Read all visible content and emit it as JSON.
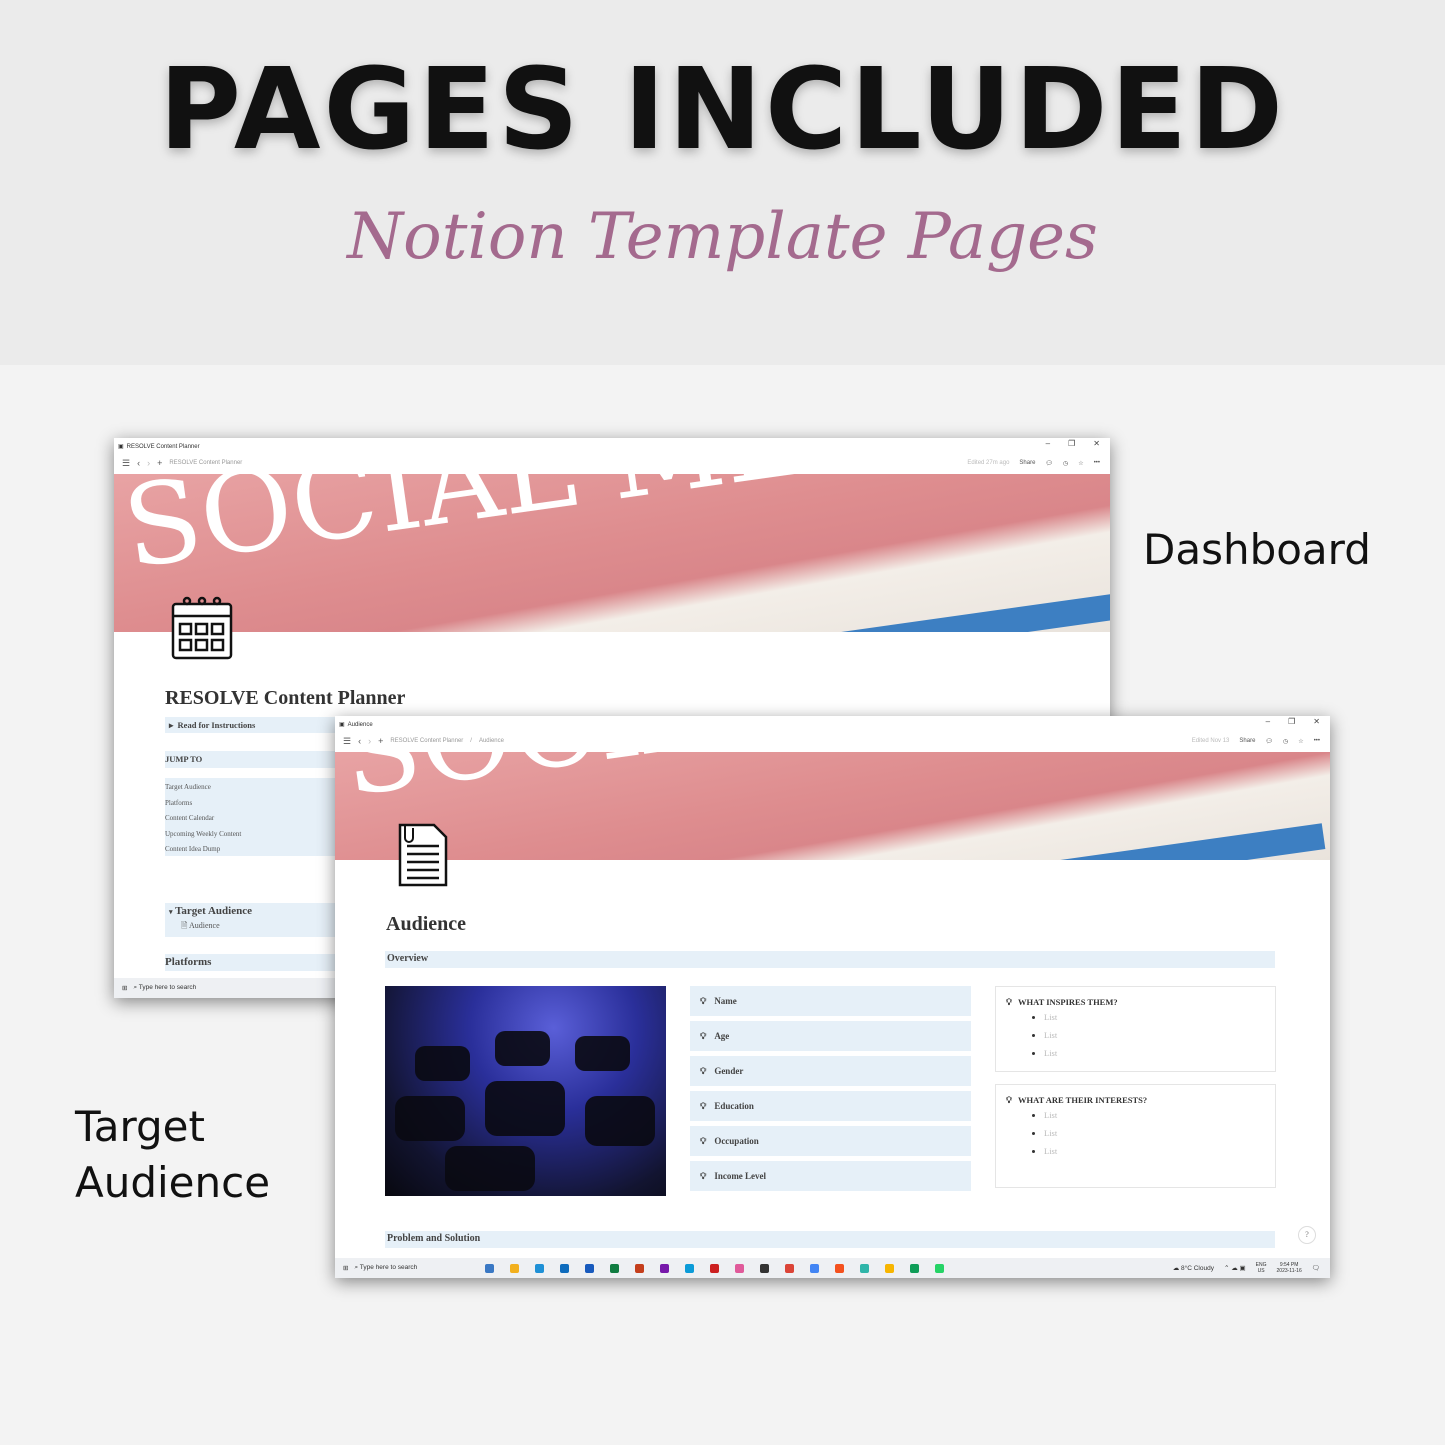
{
  "hero": {
    "title": "PAGES INCLUDED",
    "subtitle": "Notion Template Pages"
  },
  "labels": {
    "dashboard": "Dashboard",
    "target_line1": "Target",
    "target_line2": "Audience"
  },
  "dashboard": {
    "window_title": "RESOLVE Content Planner",
    "breadcrumb": "RESOLVE Content Planner",
    "edited": "Edited 27m ago",
    "share": "Share",
    "banner_text": "SOCIAL MEDIA",
    "page_icon": "calendar-icon",
    "page_title": "RESOLVE Content Planner",
    "toggle_instructions": "Read for Instructions",
    "jump_to": "JUMP TO",
    "jump_links": [
      "Target Audience",
      "Platforms",
      "Content Calendar",
      "Upcoming Weekly Content",
      "Content Idea Dump"
    ],
    "target_audience": "Target Audience",
    "audience_link": "Audience",
    "platforms": "Platforms",
    "taskbar_search": "Type here to search"
  },
  "audience": {
    "window_title": "Audience",
    "breadcrumb": [
      "RESOLVE Content Planner",
      "Audience"
    ],
    "edited": "Edited Nov 13",
    "share": "Share",
    "banner_text": "SOCIAL MEDIA",
    "page_icon": "document-icon",
    "page_title": "Audience",
    "overview": "Overview",
    "fields": [
      "Name",
      "Age",
      "Gender",
      "Education",
      "Occupation",
      "Income Level"
    ],
    "cards": [
      {
        "title": "WHAT INSPIRES THEM?",
        "items": [
          "List",
          "List",
          "List"
        ]
      },
      {
        "title": "WHAT ARE THEIR INTERESTS?",
        "items": [
          "List",
          "List",
          "List"
        ]
      }
    ],
    "problem_solution": "Problem and Solution",
    "help": "?",
    "taskbar": {
      "search": "Type here to search",
      "weather": "8°C  Cloudy",
      "lang1": "ENG",
      "lang2": "US",
      "time": "9:54 PM",
      "date": "2023-11-16",
      "app_colors": [
        "#3a78c4",
        "#f2b01e",
        "#1e90d6",
        "#0f6cbd",
        "#185abd",
        "#107c41",
        "#c43e1c",
        "#7719aa",
        "#0b9bd8",
        "#cc2020",
        "#e05a9a",
        "#333333",
        "#db4437",
        "#4285f4",
        "#f4511e",
        "#2fb5a9",
        "#f7b500",
        "#0f9d58",
        "#25d366"
      ]
    }
  },
  "colors": {
    "block_bg": "#e6f0f8",
    "subtitle": "#a46a8e",
    "banner": "#de8d8f"
  }
}
